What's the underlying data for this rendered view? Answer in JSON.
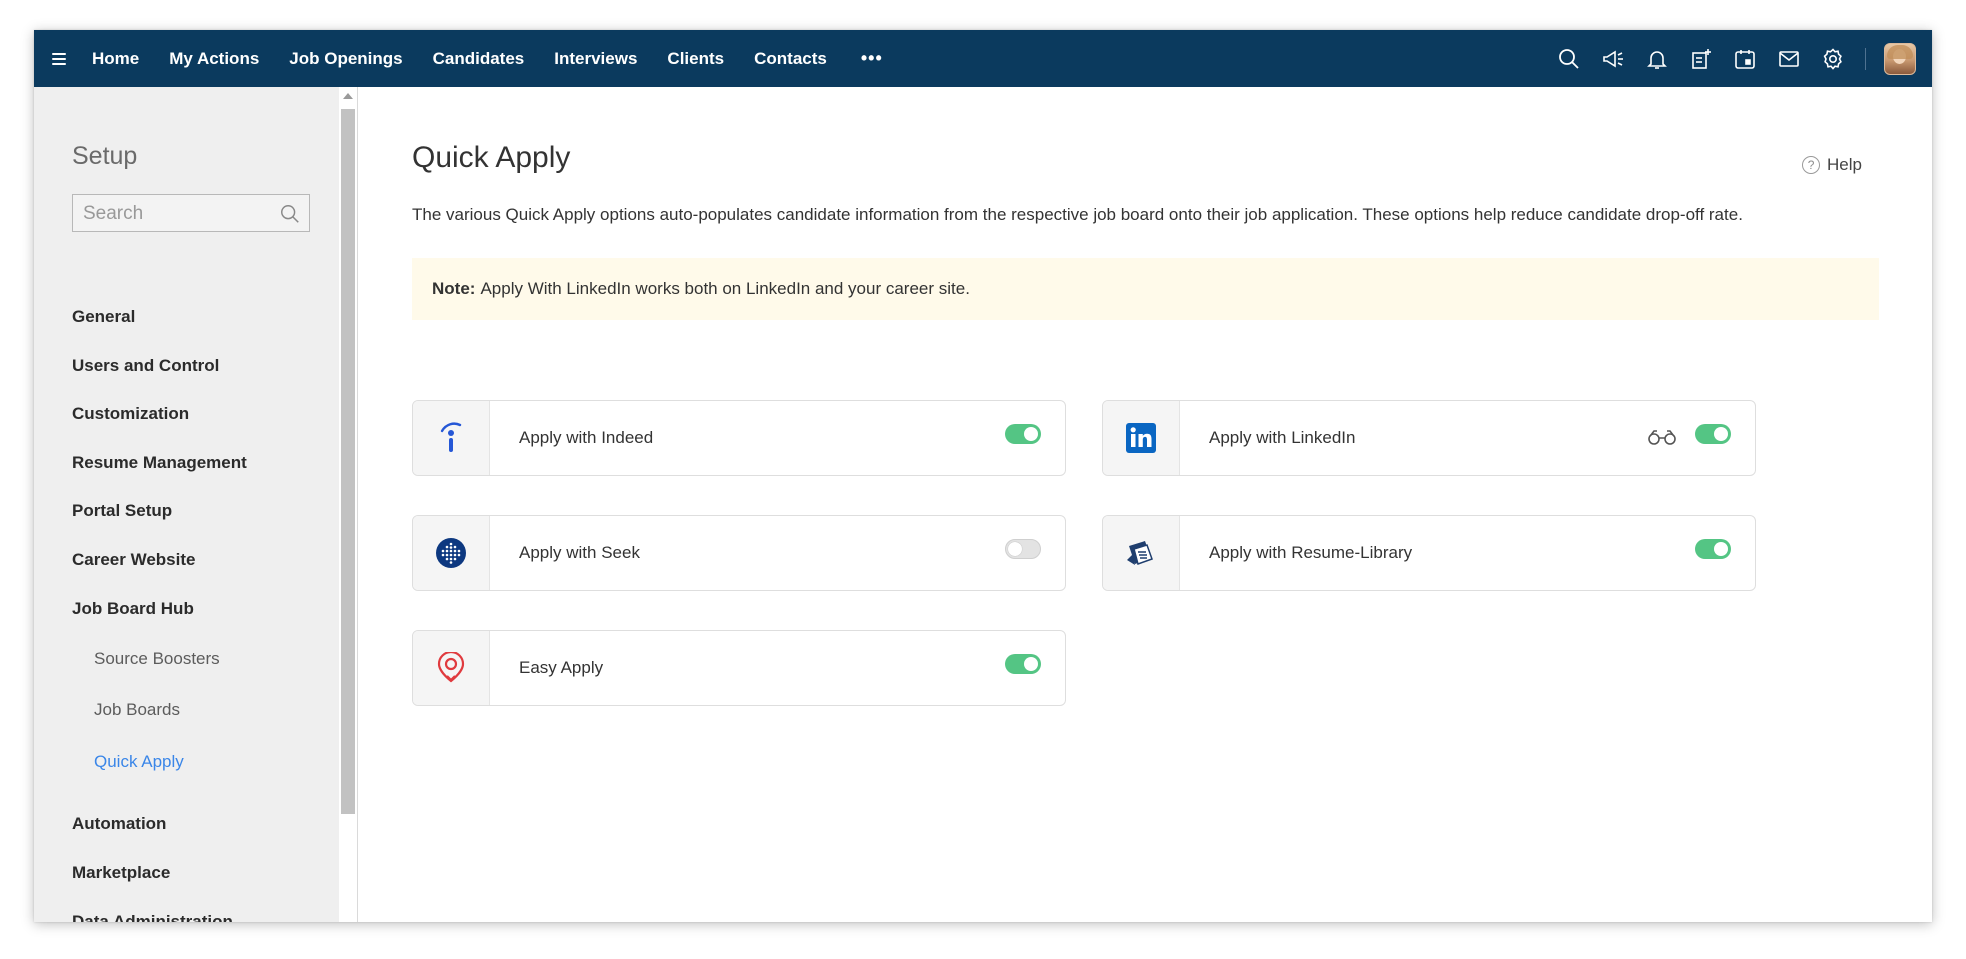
{
  "topbar": {
    "nav": [
      "Home",
      "My Actions",
      "Job Openings",
      "Candidates",
      "Interviews",
      "Clients",
      "Contacts"
    ],
    "more_label": "•••",
    "icons": [
      "search-icon",
      "announcement-icon",
      "bell-icon",
      "add-note-icon",
      "calendar-icon",
      "mail-icon",
      "settings-icon"
    ]
  },
  "sidebar": {
    "title": "Setup",
    "search_placeholder": "Search",
    "items": [
      "General",
      "Users and Control",
      "Customization",
      "Resume Management",
      "Portal Setup",
      "Career Website",
      "Job Board Hub",
      "Automation",
      "Marketplace",
      "Data Administration"
    ],
    "sub_items": [
      "Source Boosters",
      "Job Boards",
      "Quick Apply"
    ],
    "active_sub_item": "Quick Apply"
  },
  "main": {
    "title": "Quick Apply",
    "help_label": "Help",
    "description": "The various Quick Apply options auto-populates candidate information from the respective job board onto their job application. These options help reduce candidate drop-off rate.",
    "note_label": "Note:",
    "note_text": "Apply With LinkedIn works both on LinkedIn and your career site.",
    "options": [
      {
        "name": "Apply with Indeed",
        "icon": "indeed-logo-icon",
        "enabled": true
      },
      {
        "name": "Apply with LinkedIn",
        "icon": "linkedin-logo-icon",
        "enabled": true,
        "extra_icon": "binoculars-icon"
      },
      {
        "name": "Apply with Seek",
        "icon": "seek-logo-icon",
        "enabled": false
      },
      {
        "name": "Apply with Resume-Library",
        "icon": "resume-library-logo-icon",
        "enabled": true
      },
      {
        "name": "Easy Apply",
        "icon": "easy-apply-logo-icon",
        "enabled": true
      }
    ]
  },
  "colors": {
    "topbar": "#0b3a5e",
    "toggle_on": "#54c584",
    "active_link": "#3a86e8",
    "note_bg": "#fffaea"
  }
}
